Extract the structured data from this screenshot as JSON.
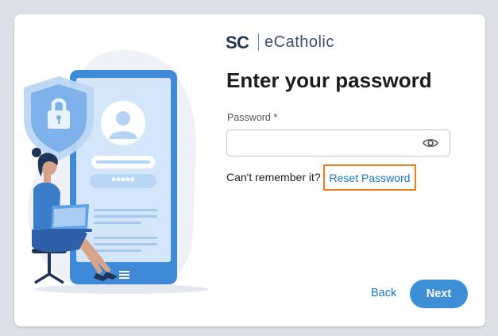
{
  "brand": {
    "name": "eCatholic",
    "mark": "SC"
  },
  "page": {
    "title": "Enter your password"
  },
  "password": {
    "label": "Password *",
    "value": "",
    "placeholder": ""
  },
  "recovery": {
    "prompt": "Can't remember it?",
    "link_label": "Reset Password"
  },
  "actions": {
    "back_label": "Back",
    "next_label": "Next"
  },
  "illustration": {
    "masked_text": "*****"
  },
  "icons": {
    "visibility": "eye-icon",
    "security": "shield-lock-icon",
    "user": "user-avatar-icon"
  },
  "colors": {
    "accent": "#3d8fd6",
    "link": "#1976c9",
    "highlight": "#f07b1b",
    "brand_dark": "#1f3457",
    "brand_blue": "#4a90d9"
  }
}
